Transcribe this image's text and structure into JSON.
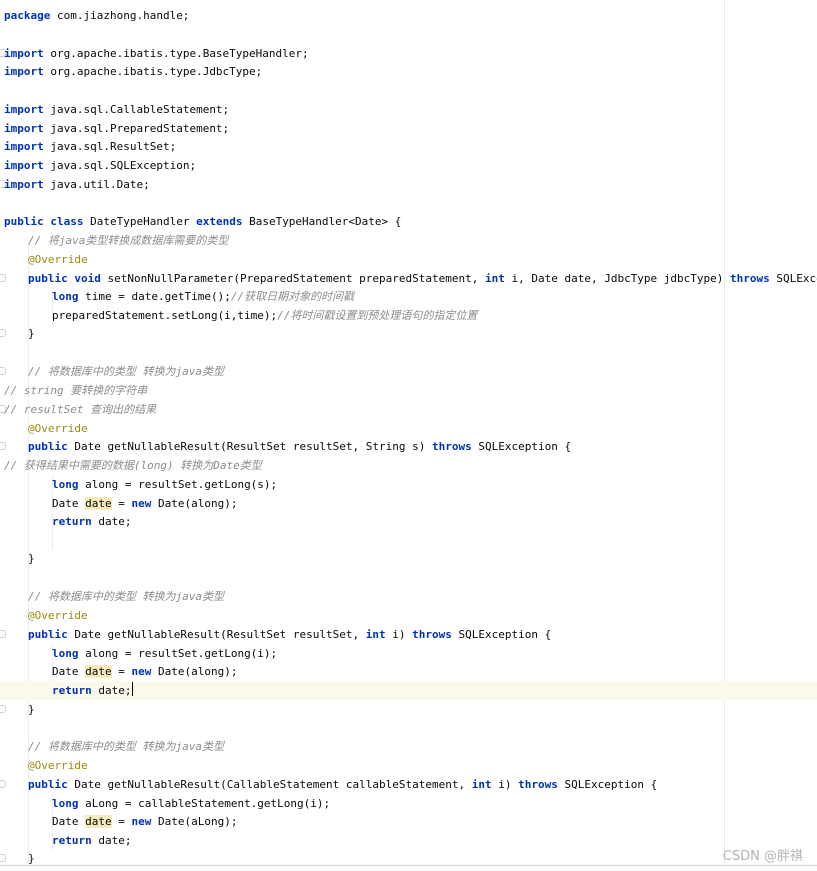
{
  "editor": {
    "lines": {
      "l1": [
        "package",
        " com.jiazhong.handle;"
      ],
      "l3": [
        "import",
        " org.apache.ibatis.type.BaseTypeHandler;"
      ],
      "l4": [
        "import",
        " org.apache.ibatis.type.JdbcType;"
      ],
      "l6": [
        "import",
        " java.sql.CallableStatement;"
      ],
      "l7": [
        "import",
        " java.sql.PreparedStatement;"
      ],
      "l8": [
        "import",
        " java.sql.ResultSet;"
      ],
      "l9": [
        "import",
        " java.sql.SQLException;"
      ],
      "l10": [
        "import",
        " java.util.Date;"
      ],
      "l12": [
        "public",
        " ",
        "class",
        " DateTypeHandler ",
        "extends",
        " BaseTypeHandler<Date> {"
      ],
      "l13": [
        "// 将java类型转换成数据库需要的类型"
      ],
      "l14": [
        "@Override"
      ],
      "l15": [
        "public",
        " ",
        "void",
        " setNonNullParameter(PreparedStatement preparedStatement, ",
        "int",
        " i, Date date, JdbcType jdbcType) ",
        "throws",
        " SQLException {"
      ],
      "l16": [
        "long",
        " time = date.getTime();",
        "//获取日期对象的时间戳"
      ],
      "l17": [
        "preparedStatement.setLong(i,time);",
        "//将时间戳设置到预处理语句的指定位置"
      ],
      "l18": [
        "}"
      ],
      "l20": [
        "// 将数据库中的类型 转换为java类型"
      ],
      "l21": [
        "// string 要转换的字符串"
      ],
      "l22": [
        "// resultSet 查询出的结果"
      ],
      "l23": [
        "@Override"
      ],
      "l24": [
        "public",
        " Date getNullableResult(ResultSet resultSet, String s) ",
        "throws",
        " SQLException {"
      ],
      "l25": [
        "// 获得结果中需要的数据(long) 转换为Date类型"
      ],
      "l26": [
        "long",
        " along = resultSet.getLong(s);"
      ],
      "l27": [
        "Date ",
        "date",
        " = ",
        "new",
        " Date(along);"
      ],
      "l28": [
        "return",
        " date;"
      ],
      "l30": [
        "}"
      ],
      "l32": [
        "// 将数据库中的类型 转换为java类型"
      ],
      "l33": [
        "@Override"
      ],
      "l34": [
        "public",
        " Date getNullableResult(ResultSet resultSet, ",
        "int",
        " i) ",
        "throws",
        " SQLException {"
      ],
      "l35": [
        "long",
        " along = resultSet.getLong(i);"
      ],
      "l36": [
        "Date ",
        "date",
        " = ",
        "new",
        " Date(along);"
      ],
      "l37": [
        "return",
        " date;"
      ],
      "l38": [
        "}"
      ],
      "l40": [
        "// 将数据库中的类型 转换为java类型"
      ],
      "l41": [
        "@Override"
      ],
      "l42": [
        "public",
        " Date getNullableResult(CallableStatement callableStatement, ",
        "int",
        " i) ",
        "throws",
        " SQLException {"
      ],
      "l43": [
        "long",
        " aLong = callableStatement.getLong(i);"
      ],
      "l44": [
        "Date ",
        "date",
        " = ",
        "new",
        " Date(aLong);"
      ],
      "l45": [
        "return",
        " date;"
      ],
      "l46": [
        "}"
      ]
    }
  },
  "watermark": "CSDN @胖祺",
  "colors": {
    "keyword": "#0033b3",
    "comment": "#8c8c8c",
    "annotation": "#9e880d",
    "usage_highlight": "#f6ebbc",
    "current_line": "#fcfaed"
  }
}
